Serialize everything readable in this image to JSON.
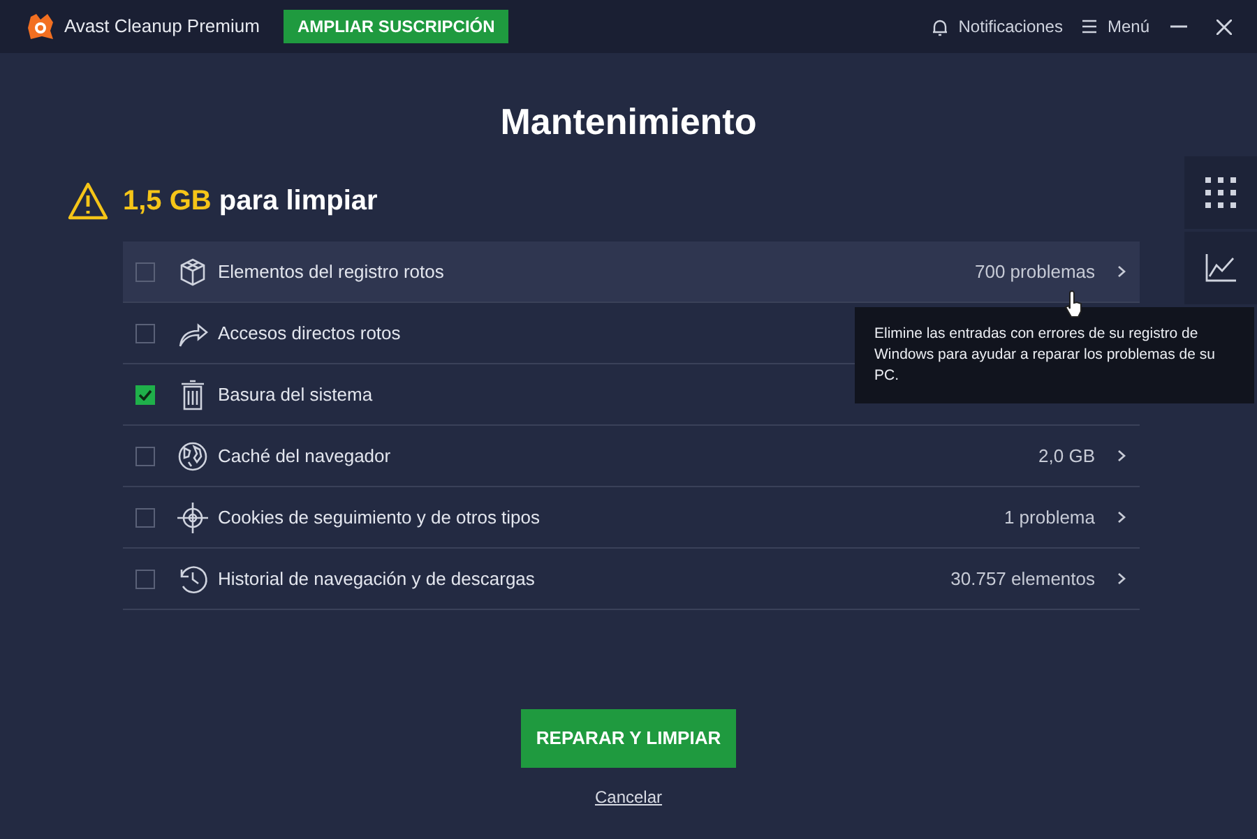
{
  "window": {
    "title": "Avast Cleanup Premium",
    "upgrade_button": "AMPLIAR SUSCRIPCIÓN",
    "notifications": "Notificaciones",
    "menu": "Menú"
  },
  "heading": "Mantenimiento",
  "summary": {
    "amount": "1,5 GB",
    "text": "para limpiar"
  },
  "items": [
    {
      "label": "Elementos del registro rotos",
      "value": "700 problemas",
      "checked": false,
      "hovered": true
    },
    {
      "label": "Accesos directos rotos",
      "checked": false,
      "hovered": false
    },
    {
      "label": "Basura del sistema",
      "checked": true,
      "hovered": false
    },
    {
      "label": "Caché del navegador",
      "value": "2,0 GB",
      "checked": false,
      "hovered": false
    },
    {
      "label": "Cookies de seguimiento y de otros tipos",
      "value": "1 problema",
      "checked": false,
      "hovered": false
    },
    {
      "label": "Historial de navegación y de descargas",
      "value": "30.757 elementos",
      "checked": false,
      "hovered": false
    }
  ],
  "tooltip": "Elimine las entradas con errores de su registro de Windows para ayudar a reparar los problemas de su PC.",
  "primary_button": "REPARAR Y LIMPIAR",
  "cancel_link": "Cancelar"
}
